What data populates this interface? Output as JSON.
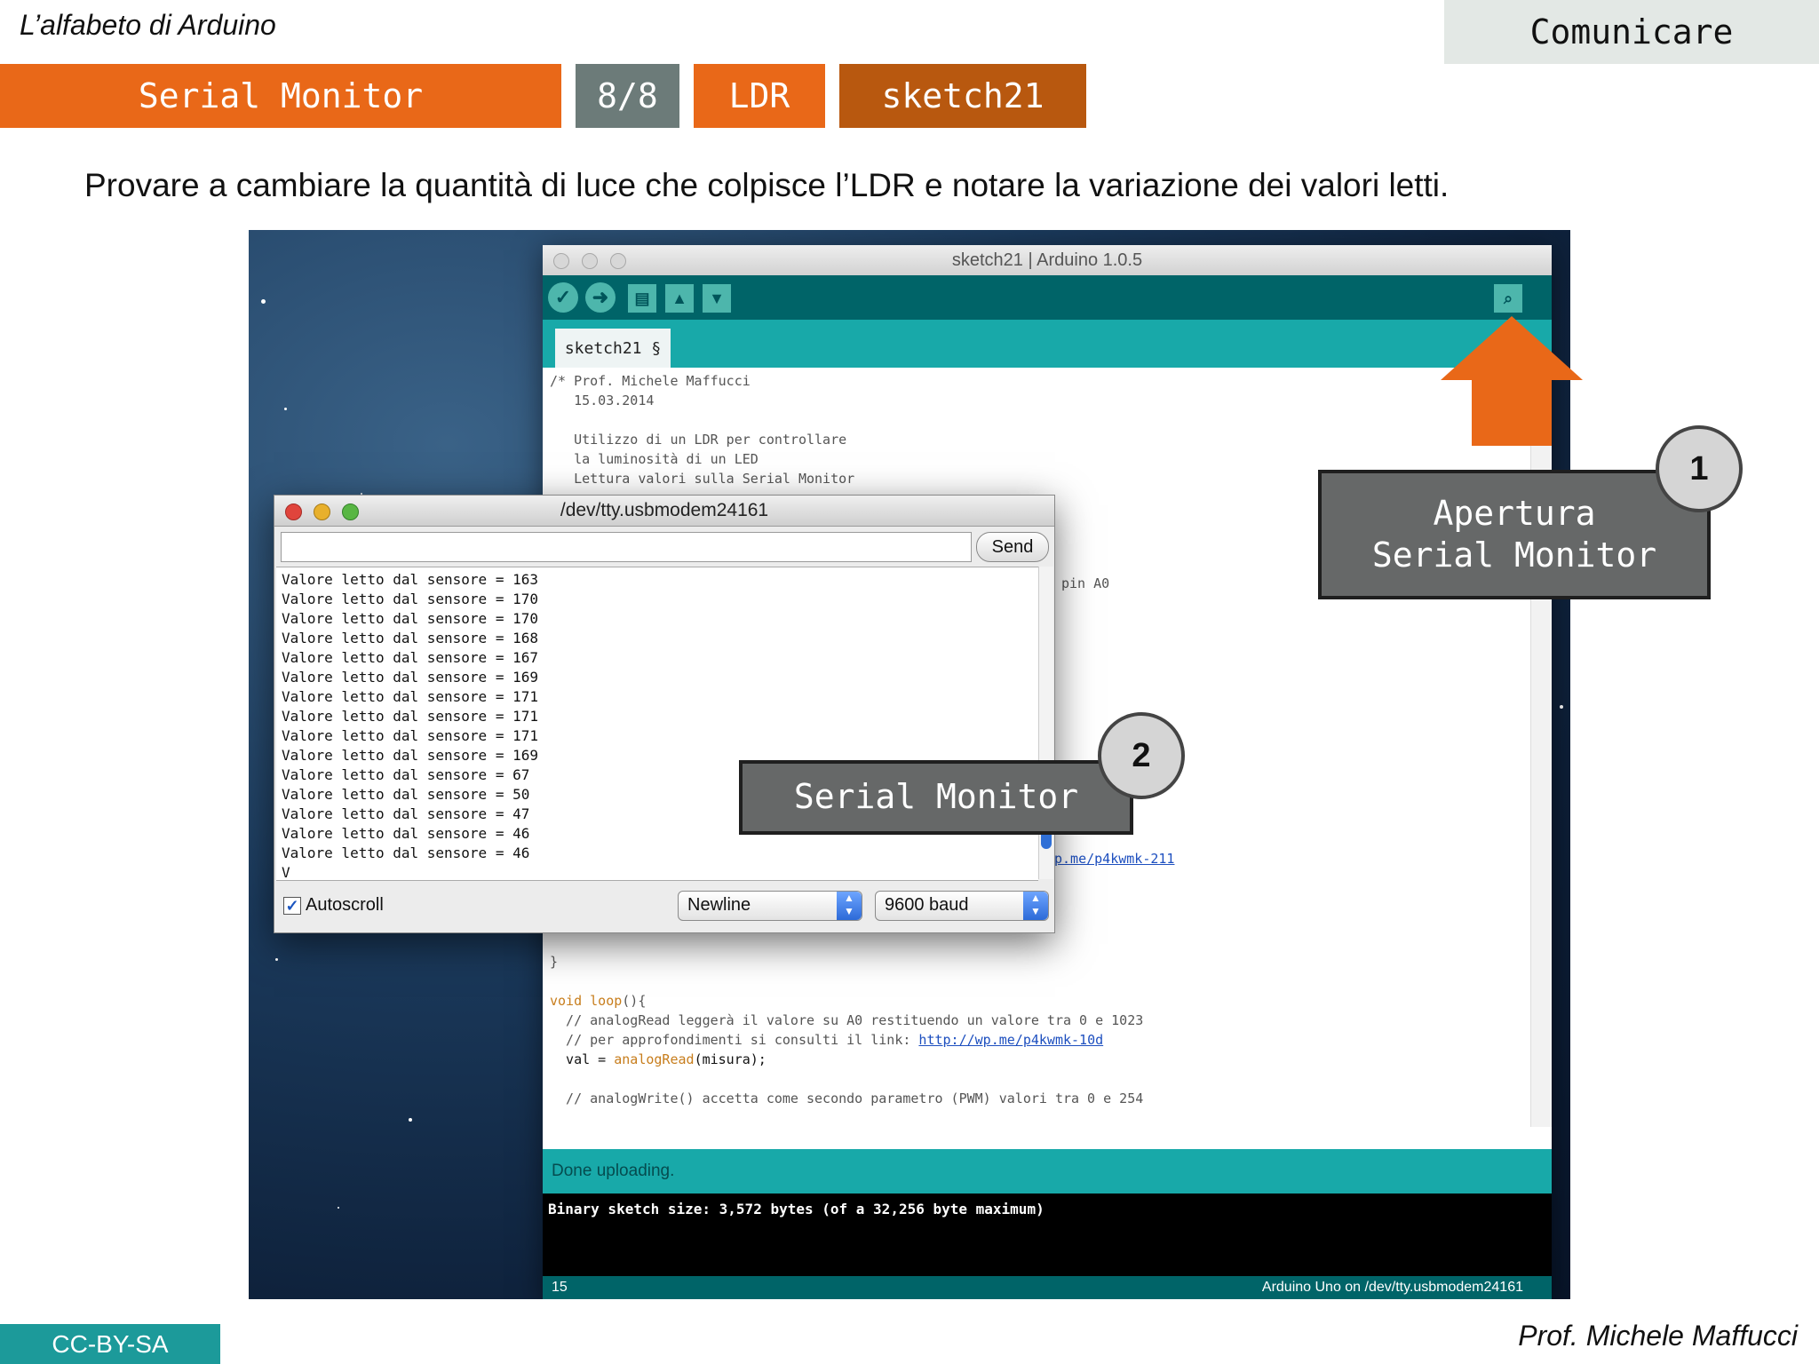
{
  "slide": {
    "course": "L’alfabeto di Arduino",
    "section": "Comunicare",
    "tags": {
      "topic": "Serial Monitor",
      "page": "8/8",
      "sensor": "LDR",
      "sketch": "sketch21"
    },
    "instruction": "Provare a cambiare la quantità di luce che colpisce l’LDR e notare la variazione dei valori letti.",
    "license": "CC-BY-SA",
    "author": "Prof. Michele Maffucci"
  },
  "ide": {
    "title": "sketch21 | Arduino 1.0.5",
    "tab": "sketch21 §",
    "toolbar_icons": [
      "verify-icon",
      "upload-icon",
      "new-icon",
      "open-icon",
      "save-icon",
      "serial-monitor-icon"
    ],
    "code": {
      "l1": "/* Prof. Michele Maffucci",
      "l2": "   15.03.2014",
      "l3": "   Utilizzo di un LDR per controllare",
      "l4": "   la luminosità di un LED",
      "l5": "   Lettura valori sulla Serial Monitor",
      "l6": "pin A0",
      "l7": "p.me/p4kwmk-211",
      "l8": "}",
      "l9_kw": "void",
      "l9_fn": "loop",
      "l9_rest": "(){",
      "l10": "  // analogRead leggerà il valore su A0 restituendo un valore tra 0 e 1023",
      "l11_pre": "  // per approfondimenti si consulti il link: ",
      "l11_link": "http://wp.me/p4kwmk-10d",
      "l12_pre": "  val = ",
      "l12_fn": "analogRead",
      "l12_post": "(misura);",
      "l13": "  // analogWrite() accetta come secondo parametro (PWM) valori tra 0 e 254"
    },
    "status": "Done uploading.",
    "console": "Binary sketch size: 3,572 bytes (of a 32,256 byte maximum)",
    "footer_line": "15",
    "footer_board": "Arduino Uno on /dev/tty.usbmodem24161"
  },
  "serial": {
    "title": "/dev/tty.usbmodem24161",
    "input_value": "",
    "send_label": "Send",
    "lines": [
      "Valore letto dal sensore = 163",
      "Valore letto dal sensore = 170",
      "Valore letto dal sensore = 170",
      "Valore letto dal sensore = 168",
      "Valore letto dal sensore = 167",
      "Valore letto dal sensore = 169",
      "Valore letto dal sensore = 171",
      "Valore letto dal sensore = 171",
      "Valore letto dal sensore = 171",
      "Valore letto dal sensore = 169",
      "Valore letto dal sensore = 67",
      "Valore letto dal sensore = 50",
      "Valore letto dal sensore = 47",
      "Valore letto dal sensore = 46",
      "Valore letto dal sensore = 46",
      "V"
    ],
    "autoscroll_label": "Autoscroll",
    "autoscroll_checked": true,
    "line_ending": "Newline",
    "baud": "9600 baud"
  },
  "callouts": {
    "c1_text": "Apertura\nSerial Monitor",
    "c1_num": "1",
    "c2_text": "Serial Monitor",
    "c2_num": "2"
  },
  "colors": {
    "orange": "#e96818",
    "teal_dark": "#006468",
    "teal": "#18a9a9",
    "gray_tag": "#6c7b79",
    "license_bg": "#1c9a9a"
  }
}
